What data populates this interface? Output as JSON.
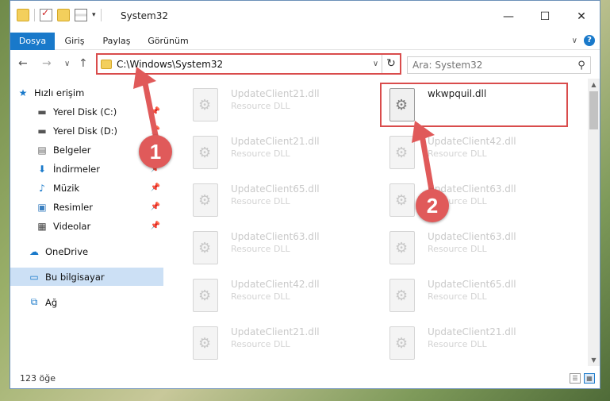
{
  "window": {
    "title": "System32",
    "minimize": "—",
    "maximize": "☐",
    "close": "✕"
  },
  "ribbon": {
    "tabs": [
      "Dosya",
      "Giriş",
      "Paylaş",
      "Görünüm"
    ],
    "help": "?",
    "expand": "∨"
  },
  "nav": {
    "back": "←",
    "forward": "→",
    "recent": "∨",
    "up": "↑",
    "address": "C:\\Windows\\System32",
    "dropdown": "∨",
    "refresh": "↻",
    "search_placeholder": "Ara: System32",
    "search_icon": "⚲"
  },
  "sidebar": {
    "items": [
      {
        "label": "Hızlı erişim",
        "icon": "star-icon",
        "pinned": false,
        "selected": false
      },
      {
        "label": "Yerel Disk (C:)",
        "icon": "drive-icon",
        "pinned": true,
        "selected": false
      },
      {
        "label": "Yerel Disk (D:)",
        "icon": "drive-icon",
        "pinned": true,
        "selected": false
      },
      {
        "label": "Belgeler",
        "icon": "documents-icon",
        "pinned": true,
        "selected": false
      },
      {
        "label": "İndirmeler",
        "icon": "download-icon",
        "pinned": true,
        "selected": false
      },
      {
        "label": "Müzik",
        "icon": "music-icon",
        "pinned": true,
        "selected": false
      },
      {
        "label": "Resimler",
        "icon": "pictures-icon",
        "pinned": true,
        "selected": false
      },
      {
        "label": "Videolar",
        "icon": "videos-icon",
        "pinned": true,
        "selected": false
      },
      {
        "label": "OneDrive",
        "icon": "cloud-icon",
        "pinned": false,
        "selected": false
      },
      {
        "label": "Bu bilgisayar",
        "icon": "computer-icon",
        "pinned": false,
        "selected": true
      },
      {
        "label": "Ağ",
        "icon": "network-icon",
        "pinned": false,
        "selected": false
      }
    ]
  },
  "files": {
    "left": [
      {
        "name": "UpdateClient21.dll",
        "type": "Resource DLL"
      },
      {
        "name": "UpdateClient21.dll",
        "type": "Resource DLL"
      },
      {
        "name": "UpdateClient65.dll",
        "type": "Resource DLL"
      },
      {
        "name": "UpdateClient63.dll",
        "type": "Resource DLL"
      },
      {
        "name": "UpdateClient42.dll",
        "type": "Resource DLL"
      },
      {
        "name": "UpdateClient21.dll",
        "type": "Resource DLL"
      }
    ],
    "right": [
      {
        "name": "wkwpquil.dll",
        "type": "",
        "highlight": true
      },
      {
        "name": "UpdateClient42.dll",
        "type": "Resource DLL"
      },
      {
        "name": "UpdateClient63.dll",
        "type": "Resource DLL"
      },
      {
        "name": "UpdateClient63.dll",
        "type": "Resource DLL"
      },
      {
        "name": "UpdateClient65.dll",
        "type": "Resource DLL"
      },
      {
        "name": "UpdateClient21.dll",
        "type": "Resource DLL"
      }
    ]
  },
  "status": {
    "item_count": "123 öğe"
  },
  "annotations": {
    "step1": "1",
    "step2": "2",
    "color": "#e05a5a"
  },
  "colors": {
    "accent": "#1979ca",
    "highlight_border": "#d94c4c",
    "selected_bg": "#cce0f5"
  }
}
